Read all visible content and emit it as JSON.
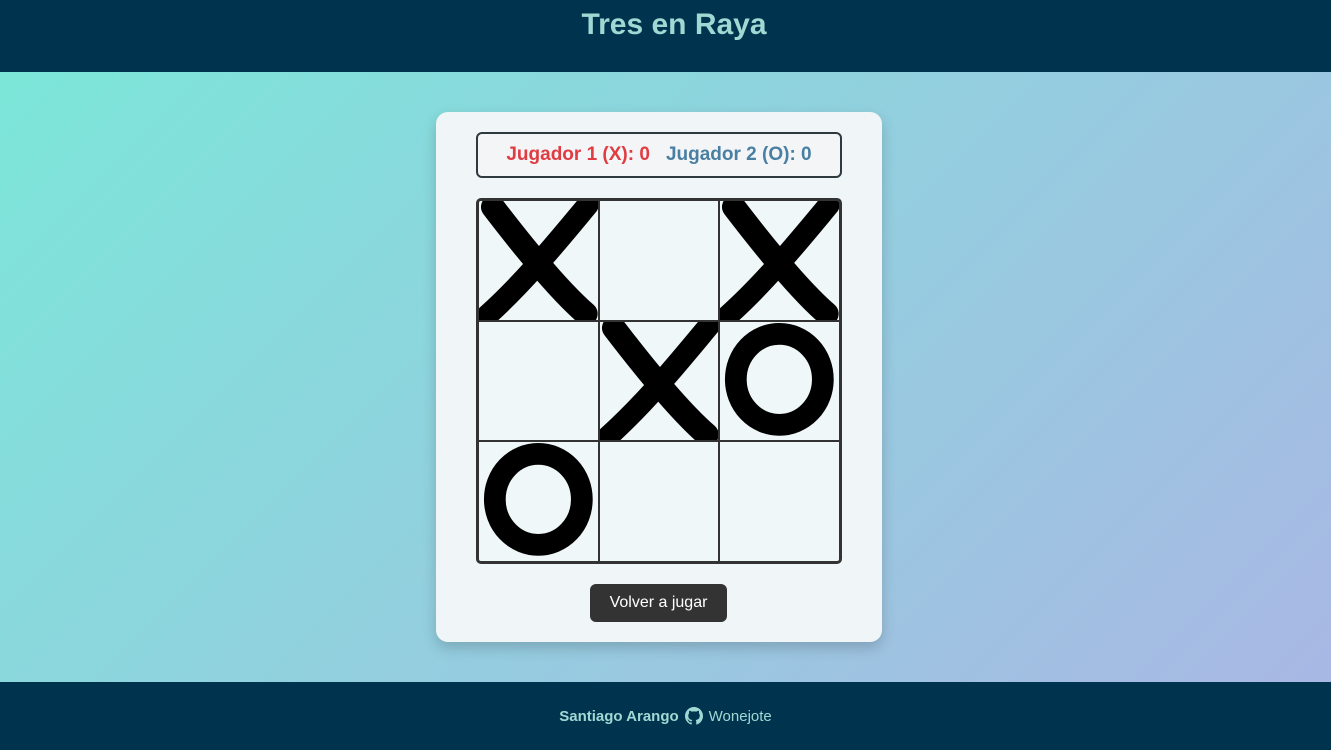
{
  "app": {
    "title": "Tres en Raya"
  },
  "score": {
    "player1_label": "Jugador 1 (X): 0",
    "player2_label": "Jugador 2 (O): 0"
  },
  "board": {
    "cells": [
      "X",
      "",
      "X",
      "",
      "X",
      "O",
      "O",
      "",
      ""
    ]
  },
  "actions": {
    "replay_label": "Volver a jugar"
  },
  "footer": {
    "author": "Santiago Arango",
    "github_icon": "github-icon",
    "github_user": "Wonejote"
  },
  "colors": {
    "header_bg": "#00334e",
    "title": "#9fd9d3",
    "player1": "#e03c42",
    "player2": "#4a7fa4",
    "button_bg": "#333333"
  }
}
